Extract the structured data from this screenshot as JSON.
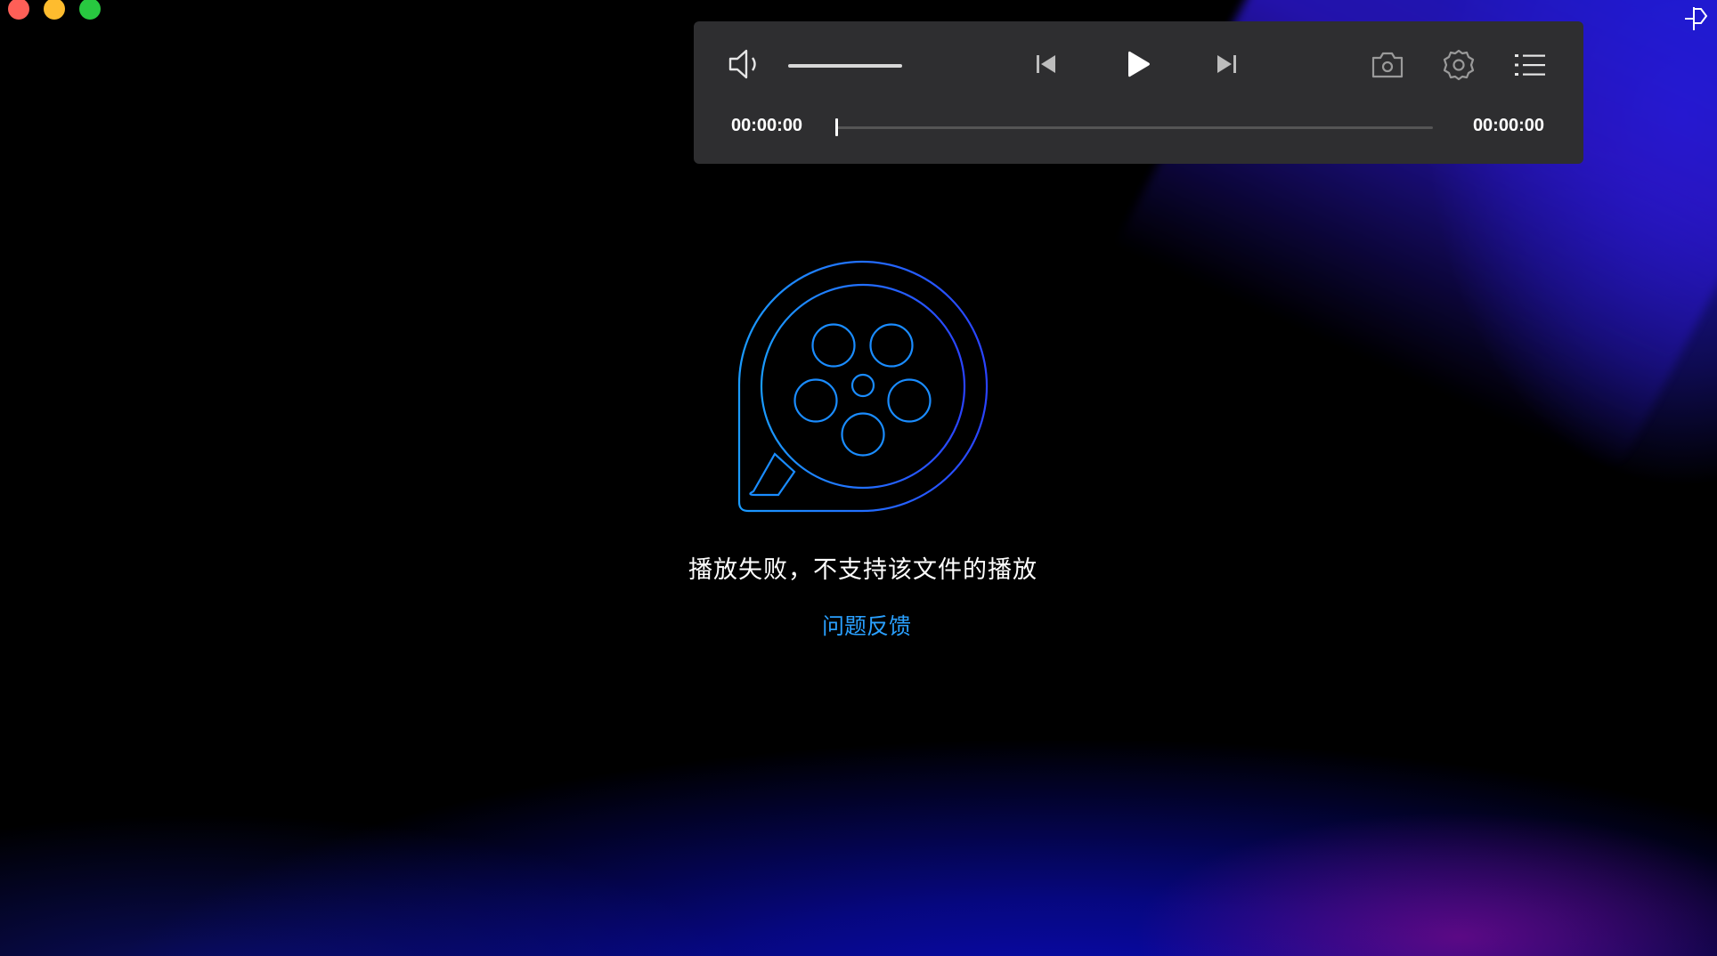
{
  "player": {
    "current_time": "00:00:00",
    "total_time": "00:00:00",
    "volume_level": 1.0,
    "progress": 0.0
  },
  "message": {
    "error": "播放失败，不支持该文件的播放",
    "feedback": "问题反馈"
  },
  "colors": {
    "accent": "#1a8cff",
    "feedback_link": "#2aa0ff",
    "control_bar": "#2e2e30",
    "background_glow": "#0a0bc4"
  },
  "icons": {
    "volume": "volume-icon",
    "previous": "skip-previous-icon",
    "play": "play-icon",
    "next": "skip-next-icon",
    "screenshot": "camera-icon",
    "settings": "gear-icon",
    "playlist": "list-icon",
    "pin": "pin-window-icon",
    "logo": "film-reel-logo-icon"
  }
}
